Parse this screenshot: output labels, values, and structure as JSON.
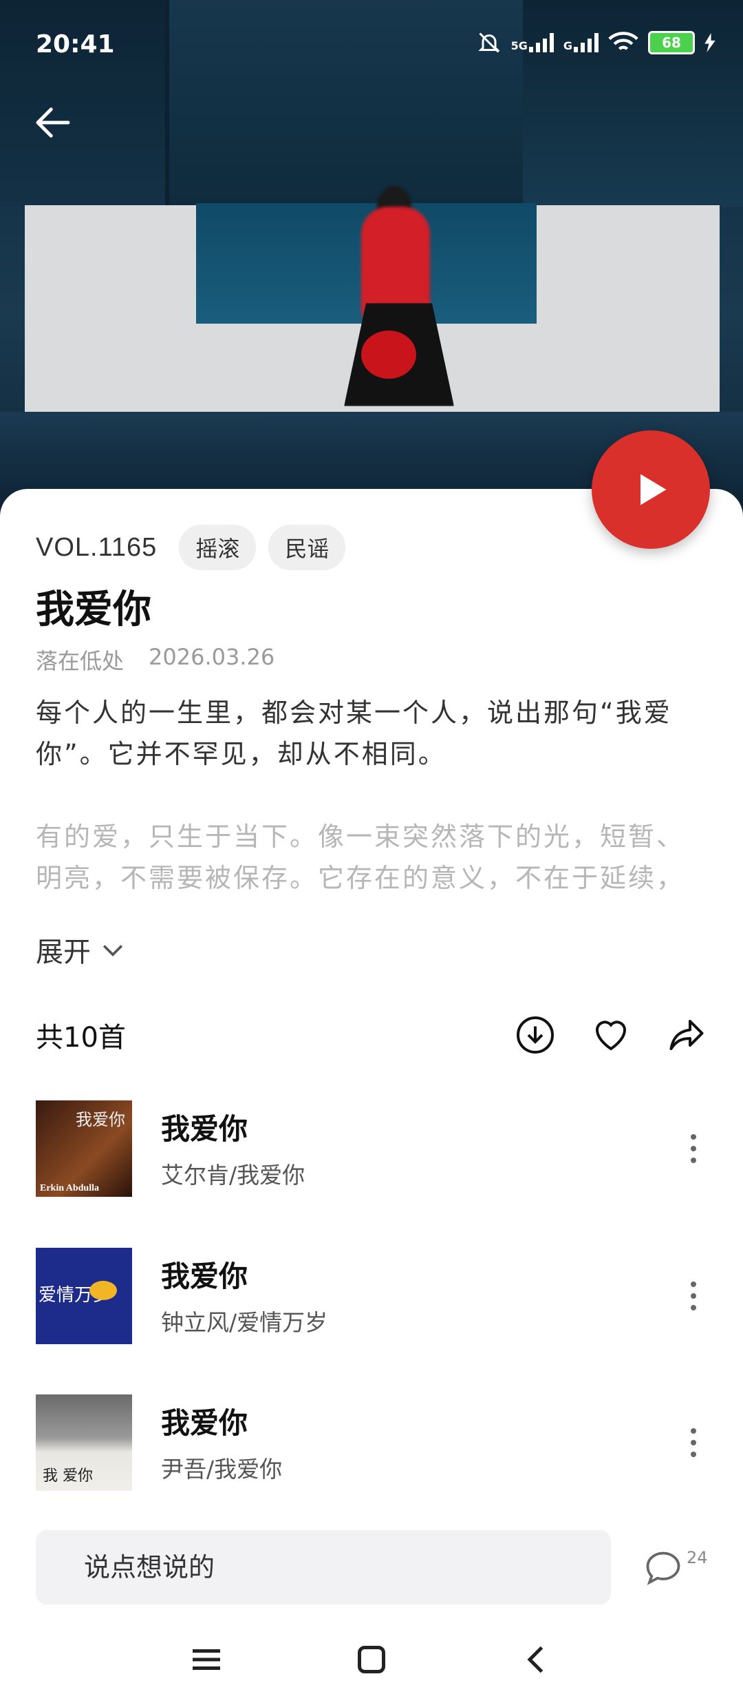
{
  "status_bar": {
    "time": "20:41",
    "battery": "68",
    "network_1": "5G",
    "network_2": "G"
  },
  "header": {
    "back_icon": "arrow-left-icon"
  },
  "album": {
    "vol": "VOL.1165",
    "tags": [
      "摇滚",
      "民谣"
    ],
    "title": "我爱你",
    "author": "落在低处",
    "date": "2026.03.26",
    "description": "每个人的一生里，都会对某一个人，说出那句“我爱你”。它并不罕见，却从不相同。",
    "description_more": "有的爱，只生于当下。像一束突然落下的光，短暂、明亮，不需要被保存。它存在的意义，不在于延续，",
    "expand_label": "展开"
  },
  "tracklist": {
    "count_label": "共10首",
    "tracks": [
      {
        "title": "我爱你",
        "subtitle": "艾尔肯/我爱你",
        "cover_text": "Erkin Abdulla",
        "cover_hand": "我爱你"
      },
      {
        "title": "我爱你",
        "subtitle": "钟立风/爱情万岁",
        "cover_text": "爱情万岁"
      },
      {
        "title": "我爱你",
        "subtitle": "尹吾/我爱你",
        "cover_text": "我 爱你"
      }
    ]
  },
  "comment": {
    "placeholder": "说点想说的",
    "count": "24"
  },
  "colors": {
    "accent": "#d9302b",
    "battery": "#4bd14b"
  }
}
